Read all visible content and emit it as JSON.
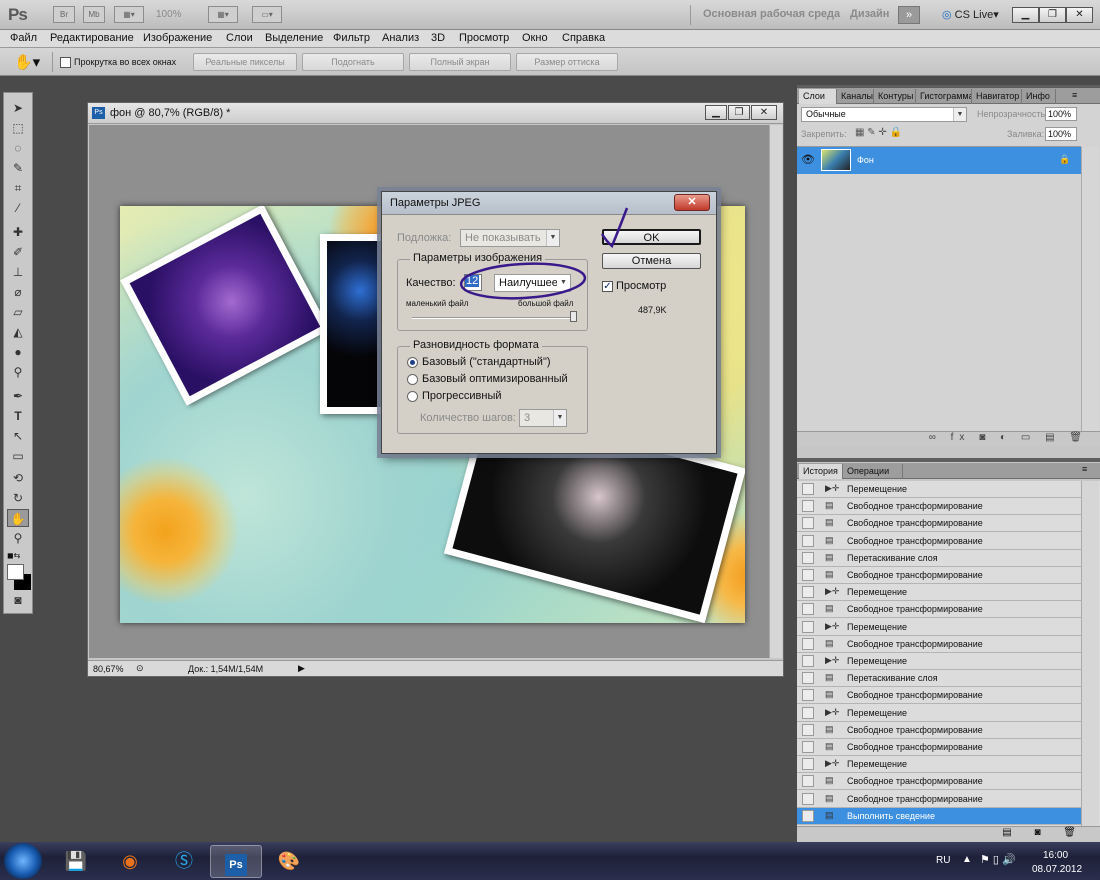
{
  "app": {
    "logo": "Ps",
    "br": "Br",
    "mb": "Mb",
    "zoom": "100%",
    "workspace": "Основная рабочая среда",
    "design": "Дизайн",
    "cs_live": "CS Live"
  },
  "menu": [
    "Файл",
    "Редактирование",
    "Изображение",
    "Слои",
    "Выделение",
    "Фильтр",
    "Анализ",
    "3D",
    "Просмотр",
    "Окно",
    "Справка"
  ],
  "options": {
    "scroll_all": "Прокрутка во всех окнах",
    "buttons": [
      "Реальные пикселы",
      "Подогнать",
      "Полный экран",
      "Размер оттиска"
    ]
  },
  "document": {
    "title": "фон @ 80,7% (RGB/8) *",
    "zoom": "80,67%",
    "doc_size": "Док.: 1,54M/1,54M"
  },
  "dialog": {
    "title": "Параметры JPEG",
    "matte_label": "Подложка:",
    "matte_value": "Не показывать",
    "image_options": "Параметры изображения",
    "quality_label": "Качество:",
    "quality_value": "12",
    "quality_preset": "Наилучшее",
    "small_file": "маленький файл",
    "large_file": "большой файл",
    "format_group": "Разновидность формата",
    "formats": [
      "Базовый (\"стандартный\")",
      "Базовый оптимизированный",
      "Прогрессивный"
    ],
    "selected_format": 0,
    "scans_label": "Количество шагов:",
    "scans_value": "3",
    "ok": "OK",
    "cancel": "Отмена",
    "preview": "Просмотр",
    "size": "487,9K"
  },
  "layers_panel": {
    "tabs": [
      "Слои",
      "Каналы",
      "Контуры",
      "Гистограмма",
      "Навигатор",
      "Инфо"
    ],
    "blend_mode": "Обычные",
    "opacity_label": "Непрозрачность:",
    "opacity": "100%",
    "lock_label": "Закрепить:",
    "fill_label": "Заливка:",
    "fill": "100%",
    "layer_name": "Фон"
  },
  "history_panel": {
    "tabs": [
      "История",
      "Операции"
    ],
    "items": [
      "Перемещение",
      "Свободное трансформирование",
      "Свободное трансформирование",
      "Свободное трансформирование",
      "Перетаскивание слоя",
      "Свободное трансформирование",
      "Перемещение",
      "Свободное трансформирование",
      "Перемещение",
      "Свободное трансформирование",
      "Перемещение",
      "Перетаскивание слоя",
      "Свободное трансформирование",
      "Перемещение",
      "Свободное трансформирование",
      "Свободное трансформирование",
      "Перемещение",
      "Свободное трансформирование",
      "Свободное трансформирование",
      "Выполнить сведение"
    ],
    "item_icons": [
      "move",
      "transform",
      "transform",
      "transform",
      "transform",
      "transform",
      "move",
      "transform",
      "move",
      "transform",
      "move",
      "transform",
      "transform",
      "move",
      "transform",
      "transform",
      "move",
      "transform",
      "transform",
      "transform"
    ]
  },
  "taskbar": {
    "lang": "RU",
    "time": "16:00",
    "date": "08.07.2012",
    "ps": "Ps"
  },
  "colors": {
    "accent": "#3d8fe0",
    "annotation": "#3a1a8a"
  }
}
